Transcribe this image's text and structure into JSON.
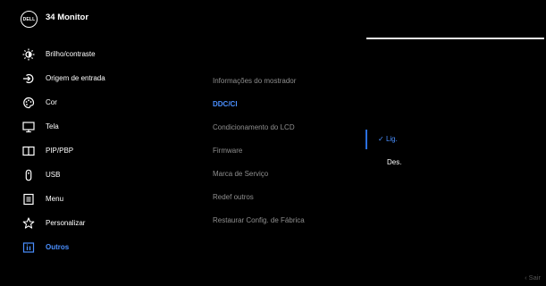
{
  "header": {
    "logo_text": "DELL",
    "title": "34 Monitor"
  },
  "menu": [
    {
      "label": "Brilho/contraste",
      "icon": "brightness-icon"
    },
    {
      "label": "Origem de entrada",
      "icon": "input-source-icon"
    },
    {
      "label": "Cor",
      "icon": "color-palette-icon"
    },
    {
      "label": "Tela",
      "icon": "display-icon"
    },
    {
      "label": "PIP/PBP",
      "icon": "pip-pbp-icon"
    },
    {
      "label": "USB",
      "icon": "usb-icon"
    },
    {
      "label": "Menu",
      "icon": "menu-icon"
    },
    {
      "label": "Personalizar",
      "icon": "star-icon"
    },
    {
      "label": "Outros",
      "icon": "others-info-icon",
      "active": true
    }
  ],
  "submenu": [
    {
      "label": "Informações do mostrador"
    },
    {
      "label": "DDC/CI",
      "active": true
    },
    {
      "label": "Condicionamento do LCD"
    },
    {
      "label": "Firmware"
    },
    {
      "label": "Marca de Serviço"
    },
    {
      "label": "Redef outros"
    },
    {
      "label": "Restaurar Config. de Fábrica"
    }
  ],
  "options": {
    "selected_mark": "✓",
    "selected": "Lig.",
    "other": "Des."
  },
  "footer": {
    "exit": "‹  Sair"
  },
  "colors": {
    "accent": "#4a8fff",
    "background": "#000000",
    "muted": "#8e8e8e"
  }
}
